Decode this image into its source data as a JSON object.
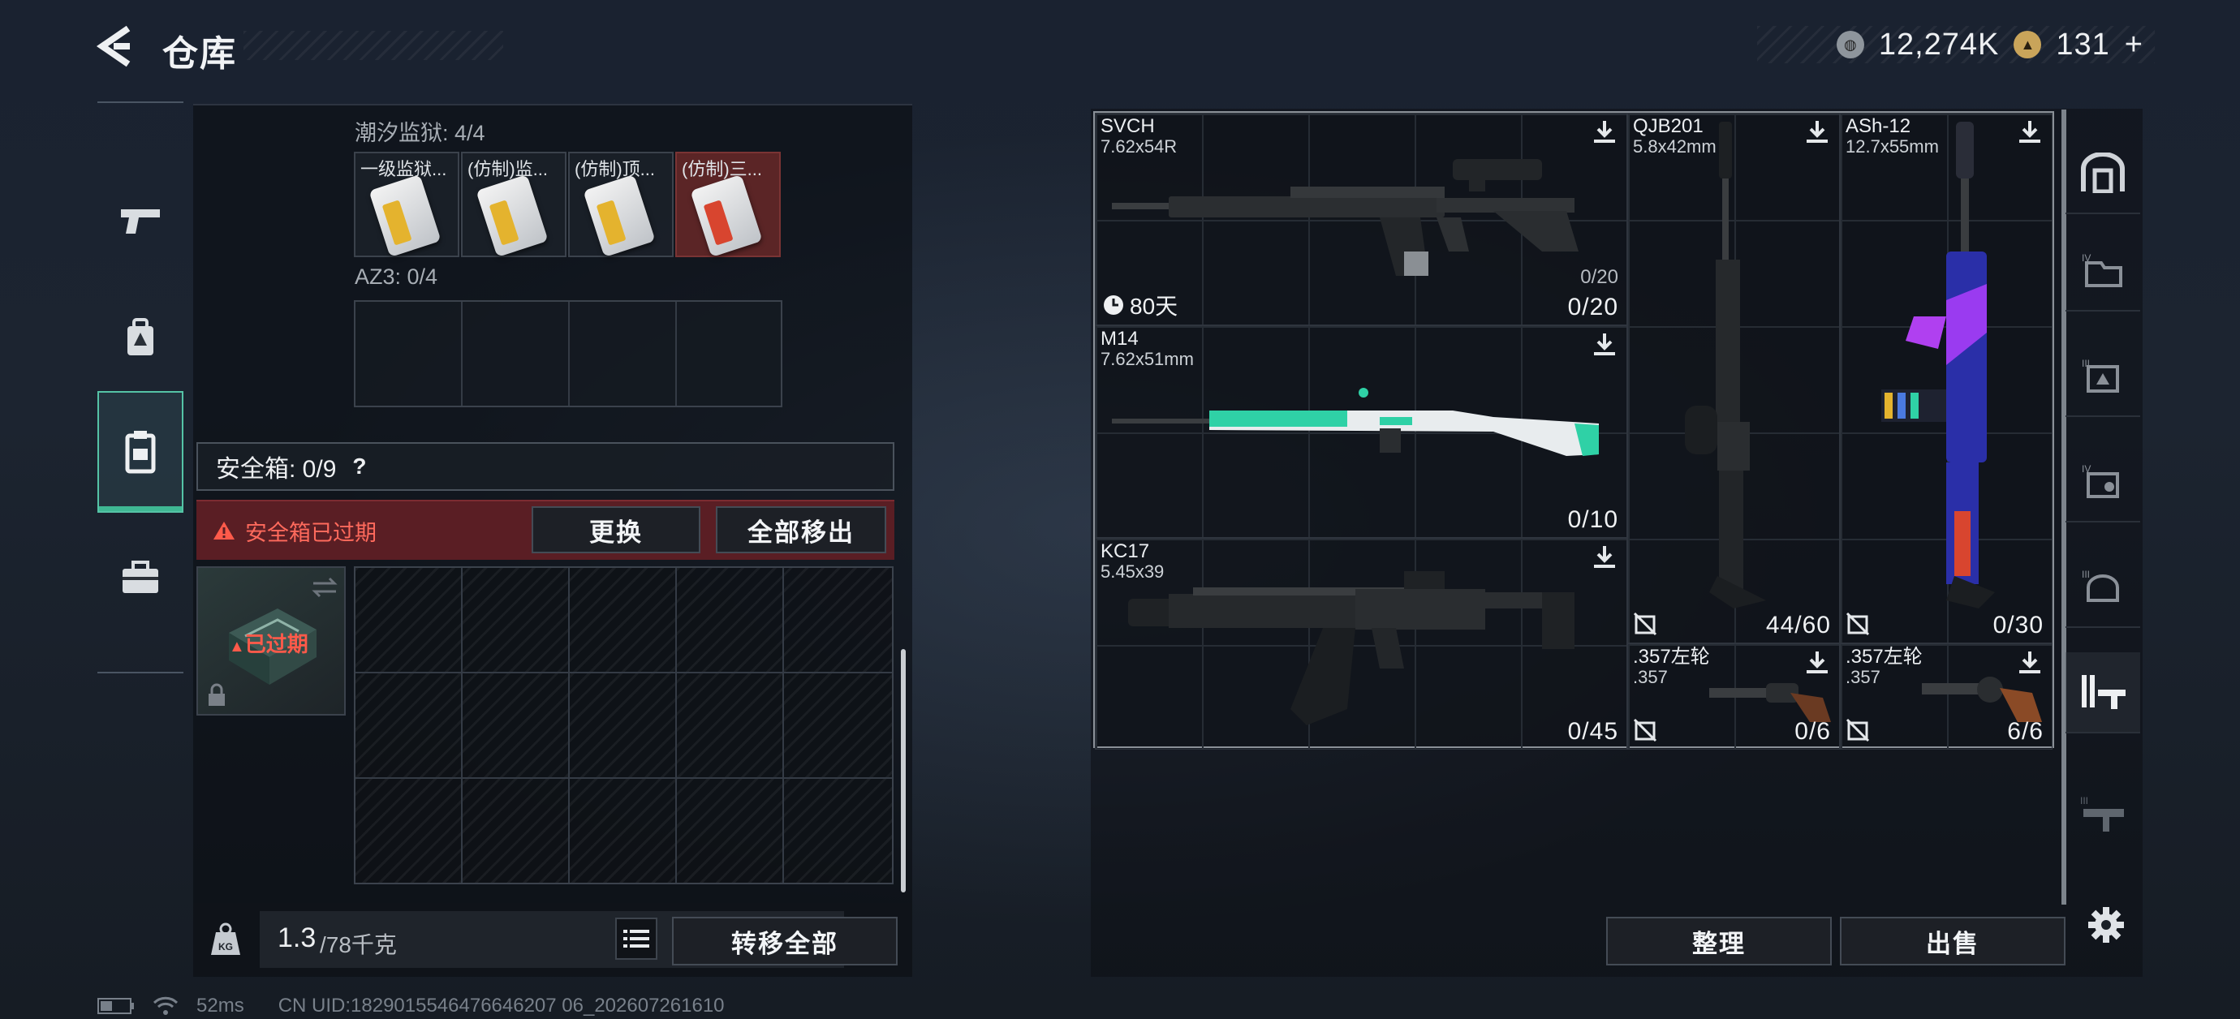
{
  "header": {
    "title": "仓库",
    "currency_primary": "12,274K",
    "currency_secondary": "131",
    "add_symbol": "+"
  },
  "left_nav": {
    "items": [
      {
        "name": "weapons",
        "icon": "pistol-icon"
      },
      {
        "name": "equipment",
        "icon": "backpack-icon"
      },
      {
        "name": "containers",
        "icon": "container-icon",
        "active": true
      },
      {
        "name": "toolbox",
        "icon": "toolbox-icon"
      }
    ]
  },
  "keycards": {
    "section_label": "潮汐监狱: 4/4",
    "cards": [
      {
        "label": "一级监狱...",
        "stripe": "#e4b32e",
        "bg": "#2b2f38"
      },
      {
        "label": "(仿制)监...",
        "stripe": "#e4b32e",
        "bg": "#2b2f38"
      },
      {
        "label": "(仿制)顶...",
        "stripe": "#e4b32e",
        "bg": "#2b2f38"
      },
      {
        "label": "(仿制)三...",
        "stripe": "#d8452f",
        "bg": "#6a2a2a"
      }
    ]
  },
  "az3": {
    "section_label": "AZ3: 0/4"
  },
  "safe_box": {
    "label": "安全箱: 0/9",
    "help": "?",
    "expired_warning": "安全箱已过期",
    "replace_button": "更换",
    "remove_all_button": "全部移出",
    "item_status": "已过期"
  },
  "weight": {
    "current": "1.3",
    "max": "/78千克",
    "transfer_all_button": "转移全部"
  },
  "weapons": [
    {
      "name": "SVCH",
      "caliber": "7.62x54R",
      "ammo": "0/20",
      "ammo_small": "0/20",
      "timer": "80天"
    },
    {
      "name": "M14",
      "caliber": "7.62x51mm",
      "ammo": "0/10"
    },
    {
      "name": "KC17",
      "caliber": "5.45x39",
      "ammo": "0/45"
    },
    {
      "name": "QJB201",
      "caliber": "5.8x42mm",
      "ammo": "44/60"
    },
    {
      "name": "ASh-12",
      "caliber": "12.7x55mm",
      "ammo": "0/30"
    },
    {
      "name": ".357左轮",
      "caliber": ".357",
      "ammo": "0/6"
    },
    {
      "name": ".357左轮",
      "caliber": ".357",
      "ammo": "6/6"
    }
  ],
  "right_nav": {
    "items": [
      "vault-icon",
      "tier-iv-folder-icon",
      "tier-iii-armor-icon",
      "tier-iv-rig-icon",
      "tier-iii-helmet-icon",
      "weapon-rack-icon",
      "tier-iii-rack-icon"
    ]
  },
  "footer_buttons": {
    "organize": "整理",
    "sell": "出售"
  },
  "status_bar": {
    "ping": "52ms",
    "uid": "CN UID:1829015546476646207 06_202607261610"
  },
  "colors": {
    "accent": "#3fb893",
    "danger": "#d8452f",
    "expired_bg": "#5a1e24"
  }
}
